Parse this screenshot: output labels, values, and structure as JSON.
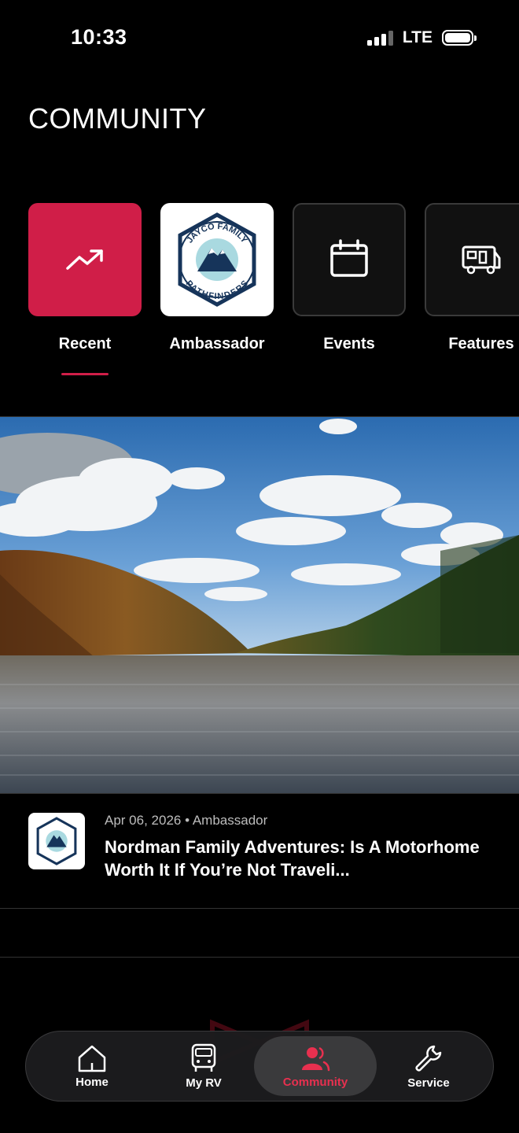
{
  "status_bar": {
    "time": "10:33",
    "network": "LTE"
  },
  "header": {
    "title": "COMMUNITY"
  },
  "categories": [
    {
      "label": "Recent",
      "icon": "trending-up-icon",
      "selected": true
    },
    {
      "label": "Ambassador",
      "icon": "jayco-family-pathfinders-logo",
      "selected": false
    },
    {
      "label": "Events",
      "icon": "calendar-icon",
      "selected": false
    },
    {
      "label": "Features",
      "icon": "rv-icon",
      "selected": false
    }
  ],
  "logo": {
    "top_text": "JAYCO FAMILY",
    "bottom_text": "PATHFINDERS"
  },
  "post": {
    "date": "Apr 06, 2026",
    "category": "Ambassador",
    "title": "Nordman Family Adventures: Is A Motorhome Worth It If You’re Not Traveli..."
  },
  "tabbar": {
    "items": [
      {
        "label": "Home",
        "icon": "home-icon"
      },
      {
        "label": "My RV",
        "icon": "rv-front-icon"
      },
      {
        "label": "Community",
        "icon": "community-icon",
        "active": true
      },
      {
        "label": "Service",
        "icon": "wrench-icon"
      }
    ]
  },
  "colors": {
    "accent": "#d01e48",
    "background": "#000000",
    "tab_active": "#e8304f"
  }
}
